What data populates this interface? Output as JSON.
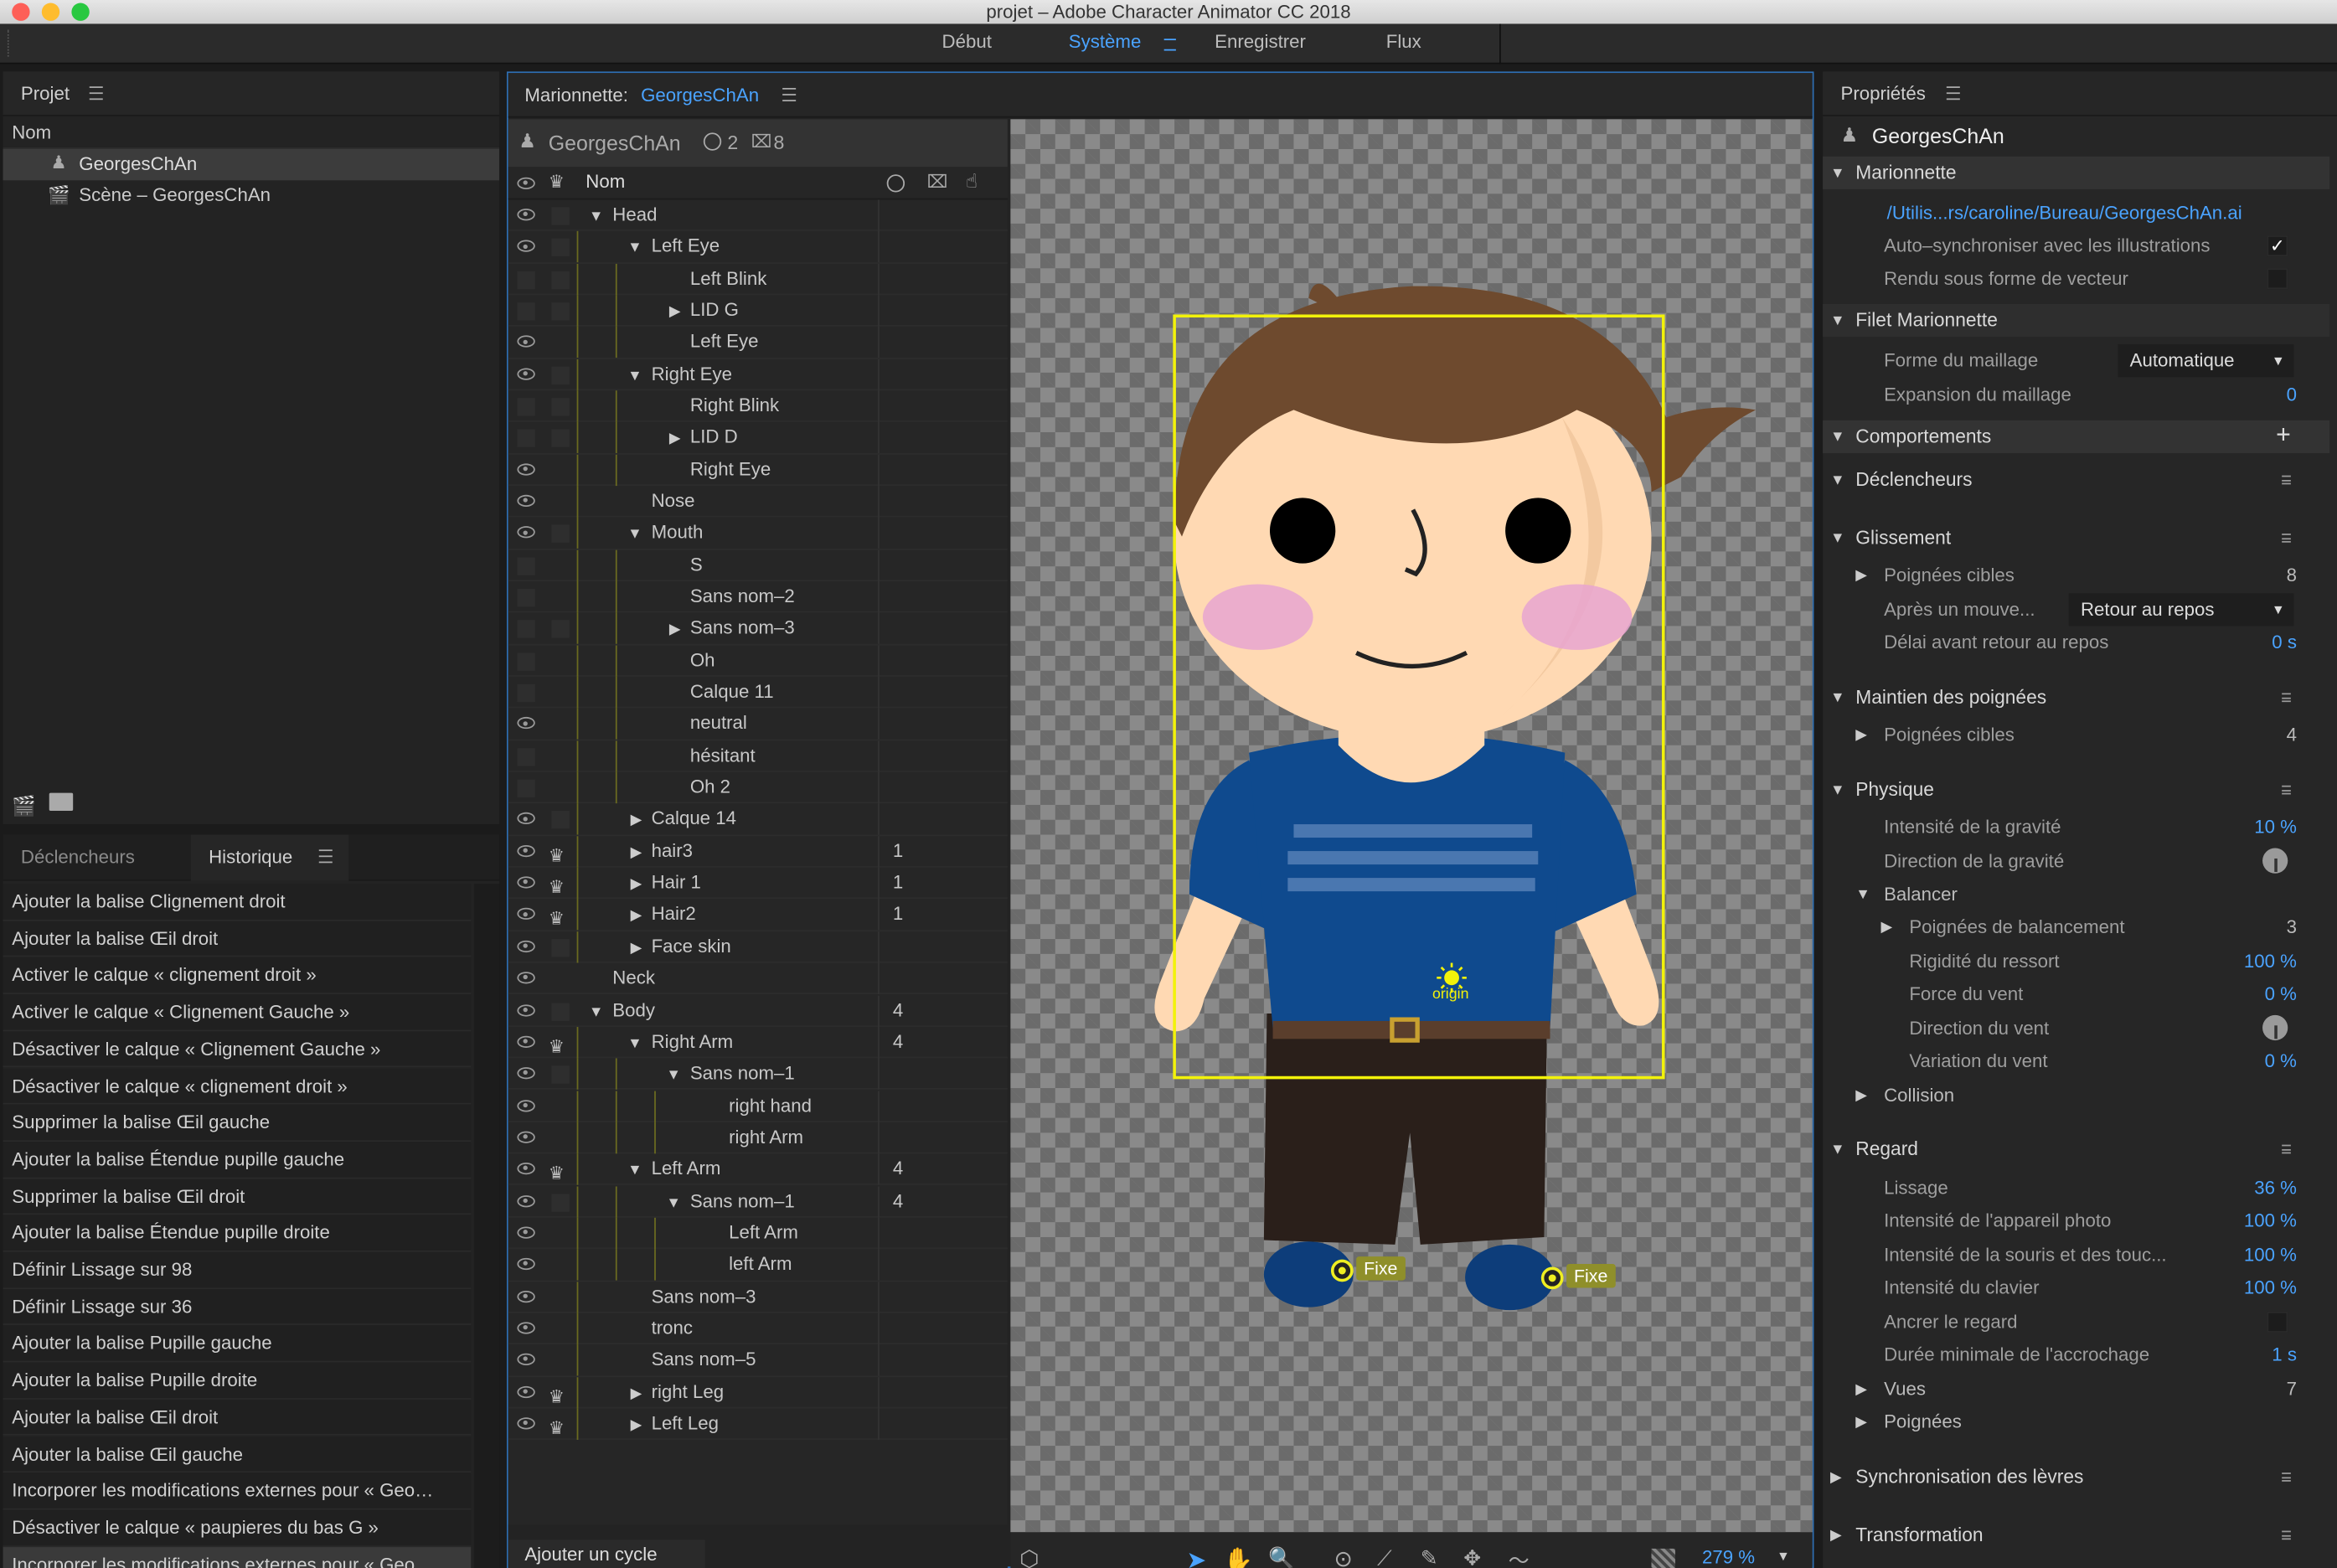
{
  "window": {
    "title": "projet – Adobe Character Animator CC 2018"
  },
  "workspaces": [
    {
      "label": "Début",
      "active": false
    },
    {
      "label": "Système",
      "active": true
    },
    {
      "label": "Enregistrer",
      "active": false
    },
    {
      "label": "Flux",
      "active": false
    }
  ],
  "project": {
    "title": "Projet",
    "column": "Nom",
    "items": [
      "GeorgesChAn",
      "Scène – GeorgesChAn"
    ]
  },
  "bottom_tabs": {
    "triggers": "Déclencheurs",
    "history": "Historique"
  },
  "history": [
    "Ajouter la balise Clignement droit",
    "Ajouter la balise Œil droit",
    "Activer le calque « clignement droit »",
    "Activer le calque « Clignement Gauche »",
    "Désactiver le calque « Clignement Gauche »",
    "Désactiver le calque « clignement droit »",
    "Supprimer la balise Œil gauche",
    "Ajouter la balise Étendue pupille gauche",
    "Supprimer la balise Œil droit",
    "Ajouter la balise Étendue pupille droite",
    "Définir Lissage sur 98",
    "Définir Lissage sur 36",
    "Ajouter la balise Pupille gauche",
    "Ajouter la balise Pupille droite",
    "Ajouter la balise Œil droit",
    "Ajouter la balise Œil gauche",
    "Incorporer les modifications externes pour « Geo…",
    "Désactiver le calque « paupieres du bas G »",
    "Incorporer les modifications externes pour « Geo…"
  ],
  "puppet": {
    "header_label": "Marionnette:",
    "header_name": "GeorgesChAn",
    "name": "GeorgesChAn",
    "count_a": "2",
    "count_b": "8",
    "column": "Nom",
    "footer_button": "Ajouter un cycle",
    "zoom": "279 %",
    "origin_label": "origin",
    "fixe_label_1": "Fixe",
    "fixe_label_2": "Fixe"
  },
  "layers": [
    {
      "name": "Head",
      "depth": 0,
      "exp": "down",
      "eye": true,
      "sq": true,
      "crown": false,
      "count": ""
    },
    {
      "name": "Left Eye",
      "depth": 1,
      "exp": "down",
      "eye": true,
      "sq": true,
      "crown": false,
      "count": ""
    },
    {
      "name": "Left Blink",
      "depth": 2,
      "exp": "",
      "eye": false,
      "sq": true,
      "crown": false,
      "count": ""
    },
    {
      "name": "LID G",
      "depth": 2,
      "exp": "right",
      "eye": false,
      "sq": true,
      "crown": false,
      "count": ""
    },
    {
      "name": "Left Eye",
      "depth": 2,
      "exp": "",
      "eye": true,
      "sq": false,
      "crown": false,
      "count": ""
    },
    {
      "name": "Right Eye",
      "depth": 1,
      "exp": "down",
      "eye": true,
      "sq": true,
      "crown": false,
      "count": ""
    },
    {
      "name": "Right Blink",
      "depth": 2,
      "exp": "",
      "eye": false,
      "sq": true,
      "crown": false,
      "count": ""
    },
    {
      "name": "LID D",
      "depth": 2,
      "exp": "right",
      "eye": false,
      "sq": true,
      "crown": false,
      "count": ""
    },
    {
      "name": "Right Eye",
      "depth": 2,
      "exp": "",
      "eye": true,
      "sq": false,
      "crown": false,
      "count": ""
    },
    {
      "name": "Nose",
      "depth": 1,
      "exp": "",
      "eye": true,
      "sq": false,
      "crown": false,
      "count": ""
    },
    {
      "name": "Mouth",
      "depth": 1,
      "exp": "down",
      "eye": true,
      "sq": true,
      "crown": false,
      "count": ""
    },
    {
      "name": "S",
      "depth": 2,
      "exp": "",
      "eye": false,
      "sq": false,
      "crown": false,
      "count": ""
    },
    {
      "name": "Sans nom–2",
      "depth": 2,
      "exp": "",
      "eye": false,
      "sq": false,
      "crown": false,
      "count": ""
    },
    {
      "name": "Sans nom–3",
      "depth": 2,
      "exp": "right",
      "eye": false,
      "sq": true,
      "crown": false,
      "count": ""
    },
    {
      "name": "Oh",
      "depth": 2,
      "exp": "",
      "eye": false,
      "sq": false,
      "crown": false,
      "count": ""
    },
    {
      "name": "Calque 11",
      "depth": 2,
      "exp": "",
      "eye": false,
      "sq": false,
      "crown": false,
      "count": ""
    },
    {
      "name": "neutral",
      "depth": 2,
      "exp": "",
      "eye": true,
      "sq": false,
      "crown": false,
      "count": ""
    },
    {
      "name": "hésitant",
      "depth": 2,
      "exp": "",
      "eye": false,
      "sq": false,
      "crown": false,
      "count": ""
    },
    {
      "name": "Oh 2",
      "depth": 2,
      "exp": "",
      "eye": false,
      "sq": false,
      "crown": false,
      "count": ""
    },
    {
      "name": "Calque 14",
      "depth": 1,
      "exp": "right",
      "eye": true,
      "sq": true,
      "crown": false,
      "count": ""
    },
    {
      "name": "hair3",
      "depth": 1,
      "exp": "right",
      "eye": true,
      "sq": false,
      "crown": true,
      "count": "1"
    },
    {
      "name": "Hair 1",
      "depth": 1,
      "exp": "right",
      "eye": true,
      "sq": false,
      "crown": true,
      "count": "1"
    },
    {
      "name": "Hair2",
      "depth": 1,
      "exp": "right",
      "eye": true,
      "sq": false,
      "crown": true,
      "count": "1"
    },
    {
      "name": "Face skin",
      "depth": 1,
      "exp": "right",
      "eye": true,
      "sq": true,
      "crown": false,
      "count": ""
    },
    {
      "name": "Neck",
      "depth": 0,
      "exp": "",
      "eye": true,
      "sq": false,
      "crown": false,
      "count": ""
    },
    {
      "name": "Body",
      "depth": 0,
      "exp": "down",
      "eye": true,
      "sq": true,
      "crown": false,
      "count": "4"
    },
    {
      "name": "Right Arm",
      "depth": 1,
      "exp": "down",
      "eye": true,
      "sq": false,
      "crown": true,
      "count": "4"
    },
    {
      "name": "Sans nom–1",
      "depth": 2,
      "exp": "down",
      "eye": true,
      "sq": true,
      "crown": false,
      "count": ""
    },
    {
      "name": "right hand",
      "depth": 3,
      "exp": "",
      "eye": true,
      "sq": false,
      "crown": false,
      "count": ""
    },
    {
      "name": "right Arm",
      "depth": 3,
      "exp": "",
      "eye": true,
      "sq": false,
      "crown": false,
      "count": ""
    },
    {
      "name": "Left Arm",
      "depth": 1,
      "exp": "down",
      "eye": true,
      "sq": false,
      "crown": true,
      "count": "4"
    },
    {
      "name": "Sans nom–1",
      "depth": 2,
      "exp": "down",
      "eye": true,
      "sq": true,
      "crown": false,
      "count": "4"
    },
    {
      "name": "Left Arm",
      "depth": 3,
      "exp": "",
      "eye": true,
      "sq": false,
      "crown": false,
      "count": ""
    },
    {
      "name": "left Arm",
      "depth": 3,
      "exp": "",
      "eye": true,
      "sq": false,
      "crown": false,
      "count": ""
    },
    {
      "name": "Sans nom–3",
      "depth": 1,
      "exp": "",
      "eye": true,
      "sq": false,
      "crown": false,
      "count": ""
    },
    {
      "name": "tronc",
      "depth": 1,
      "exp": "",
      "eye": true,
      "sq": false,
      "crown": false,
      "count": ""
    },
    {
      "name": "Sans nom–5",
      "depth": 1,
      "exp": "",
      "eye": true,
      "sq": false,
      "crown": false,
      "count": ""
    },
    {
      "name": "right Leg",
      "depth": 1,
      "exp": "right",
      "eye": true,
      "sq": false,
      "crown": true,
      "count": ""
    },
    {
      "name": "Left Leg",
      "depth": 1,
      "exp": "right",
      "eye": true,
      "sq": false,
      "crown": true,
      "count": ""
    }
  ],
  "properties": {
    "title": "Propriétés",
    "puppet_name": "GeorgesChAn",
    "sections": {
      "marionnette": "Marionnette",
      "filet": "Filet Marionnette",
      "comportements": "Comportements",
      "declencheurs": "Déclencheurs",
      "glissement": "Glissement",
      "maintien": "Maintien des poignées",
      "physique": "Physique",
      "regard": "Regard",
      "lip_sync": "Synchronisation des lèvres",
      "transformation": "Transformation"
    },
    "path": "/Utilis...rs/caroline/Bureau/GeorgesChAn.ai",
    "auto_sync": "Auto–synchroniser avec les illustrations",
    "vector_render": "Rendu sous forme de vecteur",
    "mesh_shape_label": "Forme du maillage",
    "mesh_shape_value": "Automatique",
    "mesh_expansion_label": "Expansion du maillage",
    "mesh_expansion_value": "0",
    "drag_handles_label": "Poignées cibles",
    "drag_handles_value": "8",
    "after_move_label": "Après un mouve...",
    "after_move_value": "Retour au repos",
    "delay_label": "Délai avant retour au repos",
    "delay_value": "0 s",
    "hold_handles_label": "Poignées cibles",
    "hold_handles_value": "4",
    "gravity_label": "Intensité de la gravité",
    "gravity_value": "10 %",
    "gravity_dir_label": "Direction de la gravité",
    "dangle_label": "Balancer",
    "dangle_handles_label": "Poignées de balancement",
    "dangle_handles_value": "3",
    "spring_label": "Rigidité du ressort",
    "spring_value": "100 %",
    "wind_label": "Force du vent",
    "wind_value": "0 %",
    "wind_dir_label": "Direction du vent",
    "wind_var_label": "Variation du vent",
    "wind_var_value": "0 %",
    "collision_label": "Collision",
    "smoothing_label": "Lissage",
    "smoothing_value": "36 %",
    "camera_label": "Intensité de l'appareil photo",
    "camera_value": "100 %",
    "mouse_label": "Intensité de la souris et des touc...",
    "mouse_value": "100 %",
    "keyboard_label": "Intensité du clavier",
    "keyboard_value": "100 %",
    "anchor_label": "Ancrer le regard",
    "min_hold_label": "Durée minimale de l'accrochage",
    "min_hold_value": "1 s",
    "views_label": "Vues",
    "views_value": "7",
    "handles_label": "Poignées"
  },
  "colors": {
    "accent": "#4aa3ff",
    "selection_box": "#f2f20a",
    "shirt": "#0f4a8e",
    "skin": "#ffd9b3",
    "hair": "#6e4a2e"
  }
}
